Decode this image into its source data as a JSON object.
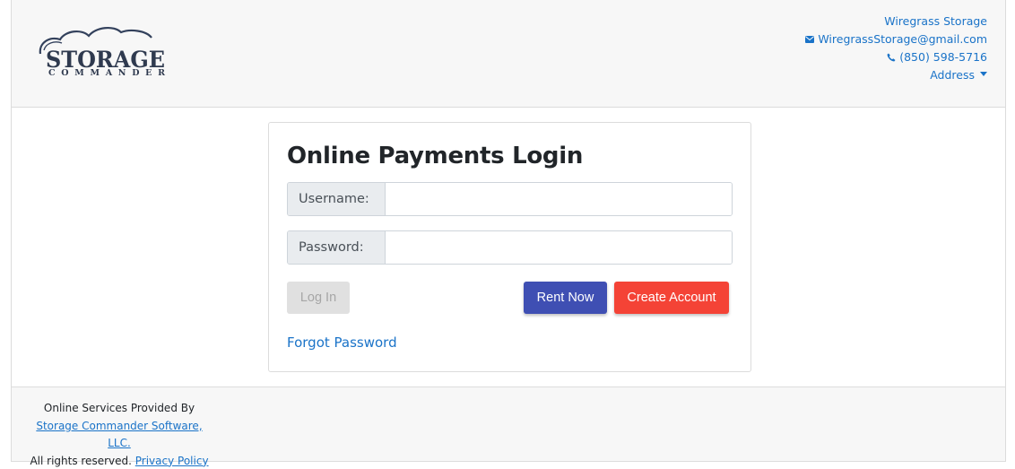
{
  "header": {
    "logo": {
      "line1": "STORAGE",
      "line2": "COMMANDER"
    },
    "contact": {
      "company": "Wiregrass Storage",
      "email": "WiregrassStorage@gmail.com",
      "phone": "(850) 598-5716",
      "address_label": "Address"
    },
    "icons": [
      "envelope-icon",
      "phone-icon",
      "caret-down-icon"
    ],
    "link_color": "#1a73c8"
  },
  "login": {
    "title": "Online Payments Login",
    "username_label": "Username:",
    "username_value": "",
    "password_label": "Password:",
    "password_value": "",
    "login_button": "Log In",
    "rent_button": "Rent Now",
    "create_button": "Create Account",
    "forgot_link": "Forgot Password"
  },
  "footer": {
    "line1": "Online Services Provided By",
    "provider_link": "Storage Commander Software, LLC.",
    "rights": "All rights reserved.",
    "privacy_link": "Privacy Policy"
  },
  "colors": {
    "rent_button": "#3f4fb3",
    "create_button": "#f44336",
    "disabled_button": "#e0e0e0",
    "panel_background": "#f7f7f7"
  }
}
